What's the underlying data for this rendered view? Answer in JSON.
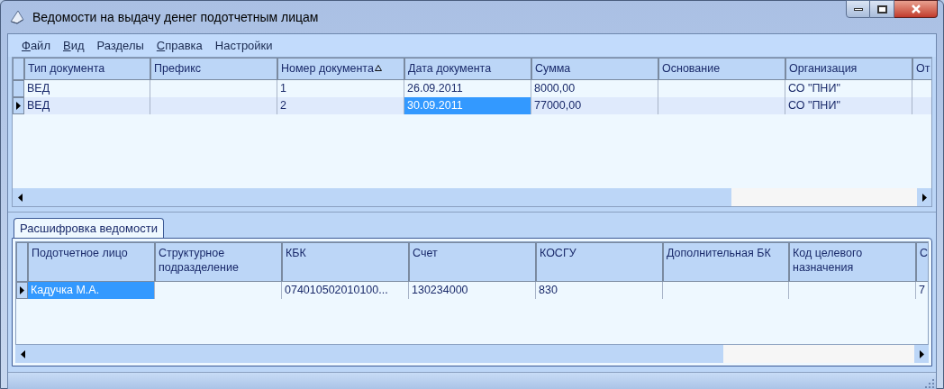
{
  "window": {
    "title": "Ведомости на выдачу денег подотчетным лицам"
  },
  "menu": [
    {
      "label": "Файл",
      "mnemonic": true
    },
    {
      "label": "Вид",
      "mnemonic": true
    },
    {
      "label": "Разделы",
      "mnemonic": false
    },
    {
      "label": "Справка",
      "mnemonic": true
    },
    {
      "label": "Настройки",
      "mnemonic": false
    }
  ],
  "documents": {
    "columns": [
      {
        "label": "Тип документа",
        "focused": false,
        "sorted": false
      },
      {
        "label": "Префикс",
        "focused": false,
        "sorted": false
      },
      {
        "label": "Номер документа",
        "focused": false,
        "sorted": true
      },
      {
        "label": "Дата документа",
        "focused": true,
        "sorted": false
      },
      {
        "label": "Сумма",
        "focused": false,
        "sorted": false
      },
      {
        "label": "Основание",
        "focused": false,
        "sorted": false
      },
      {
        "label": "Организация",
        "focused": false,
        "sorted": false
      },
      {
        "label": "От",
        "focused": false,
        "sorted": false
      }
    ],
    "rows": [
      {
        "selected": false,
        "cells": [
          "ВЕД",
          "",
          "1",
          "26.09.2011",
          "8000,00",
          "",
          "СО \"ПНИ\"",
          ""
        ]
      },
      {
        "selected": true,
        "cells": [
          "ВЕД",
          "",
          "2",
          "30.09.2011",
          "77000,00",
          "",
          "СО \"ПНИ\"",
          ""
        ]
      }
    ]
  },
  "tabs": [
    {
      "label": "Расшифровка ведомости",
      "selected": true
    }
  ],
  "details": {
    "columns": [
      {
        "label": "Подотчетное лицо",
        "focused": true
      },
      {
        "label": "Структурное подразделение",
        "focused": false
      },
      {
        "label": "КБК",
        "focused": false
      },
      {
        "label": "Счет",
        "focused": false
      },
      {
        "label": "КОСГУ",
        "focused": false
      },
      {
        "label": "Дополнительная БК",
        "focused": false
      },
      {
        "label": "Код целевого назначения",
        "focused": false
      },
      {
        "label": "С",
        "focused": false
      }
    ],
    "rows": [
      {
        "selected": true,
        "cells": [
          "Кадучка М.А.",
          "",
          "074010502010100...",
          "130234000",
          "830",
          "",
          "",
          "7"
        ]
      }
    ]
  }
}
